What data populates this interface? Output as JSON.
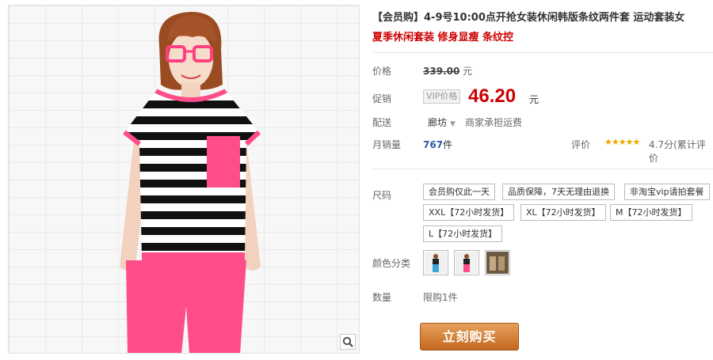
{
  "product": {
    "title": "【会员购】4-9号10:00点开抢女装休闲韩版条纹两件套 运动套装女",
    "subtitle": "夏季休闲套装 修身显瘦 条纹控"
  },
  "labels": {
    "price": "价格",
    "promo": "促销",
    "delivery": "配送",
    "monthly_sales": "月销量",
    "rating": "评价",
    "size": "尺码",
    "color": "颜色分类",
    "quantity": "数量"
  },
  "pricing": {
    "original": "339.00",
    "original_unit": "元",
    "vip_tag": "VIP价格",
    "current": "46.20",
    "current_unit": "元"
  },
  "delivery": {
    "location": "廊坊",
    "shipping": "商家承担运费"
  },
  "sales": {
    "count": "767",
    "unit": "件"
  },
  "rating": {
    "stars": "★★★★★",
    "score": "4.7分",
    "cumulative": "(累计评价"
  },
  "sizes": [
    "会员购仅此一天",
    "品质保障，7天无理由退换",
    "非淘宝vip请拍套餐",
    "XXL【72小时发货】",
    "XL【72小时发货】",
    "M【72小时发货】",
    "L【72小时发货】"
  ],
  "quantity": {
    "limit": "限购1件"
  },
  "buy_button": "立刻购买",
  "colors": {
    "price_red": "#cc0000",
    "accent_pink": "#ff4d8a",
    "button_orange": "#d07a2c"
  }
}
